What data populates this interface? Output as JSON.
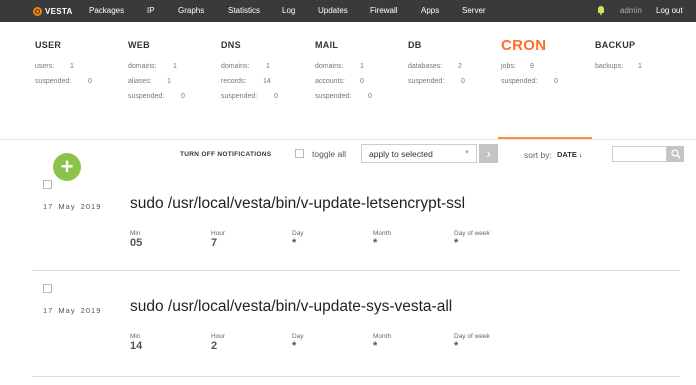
{
  "brand": {
    "logo_text": "VESTA"
  },
  "nav": {
    "items": [
      "Packages",
      "IP",
      "Graphs",
      "Statistics",
      "Log",
      "Updates",
      "Firewall",
      "Apps",
      "Server"
    ],
    "user": "admin",
    "logout": "Log out"
  },
  "stats": [
    {
      "title": "USER",
      "lines": [
        {
          "label": "users:",
          "value": "1"
        },
        {
          "label": "suspended:",
          "value": "0"
        }
      ]
    },
    {
      "title": "WEB",
      "lines": [
        {
          "label": "domains:",
          "value": "1"
        },
        {
          "label": "aliases:",
          "value": "1"
        },
        {
          "label": "suspended:",
          "value": "0"
        }
      ]
    },
    {
      "title": "DNS",
      "lines": [
        {
          "label": "domains:",
          "value": "1"
        },
        {
          "label": "records:",
          "value": "14"
        },
        {
          "label": "suspended:",
          "value": "0"
        }
      ]
    },
    {
      "title": "MAIL",
      "lines": [
        {
          "label": "domains:",
          "value": "1"
        },
        {
          "label": "accounts:",
          "value": "0"
        },
        {
          "label": "suspended:",
          "value": "0"
        }
      ]
    },
    {
      "title": "DB",
      "lines": [
        {
          "label": "databases:",
          "value": "2"
        },
        {
          "label": "suspended:",
          "value": "0"
        }
      ]
    },
    {
      "title": "CRON",
      "lines": [
        {
          "label": "jobs:",
          "value": "9"
        },
        {
          "label": "suspended:",
          "value": "0"
        }
      ]
    },
    {
      "title": "BACKUP",
      "lines": [
        {
          "label": "backups:",
          "value": "1"
        }
      ]
    }
  ],
  "toolbar": {
    "add": "+",
    "notifications": "TURN OFF NOTIFICATIONS",
    "toggle_all": "toggle all",
    "apply_selected": "apply to selected",
    "sort_by": "sort by:",
    "sort_value": "DATE ↓"
  },
  "field_labels": [
    "Min",
    "Hour",
    "Day",
    "Month",
    "Day of week"
  ],
  "jobs": [
    {
      "date": "17 May 2019",
      "command": "sudo /usr/local/vesta/bin/v-update-letsencrypt-ssl",
      "values": [
        "05",
        "7",
        "*",
        "*",
        "*"
      ]
    },
    {
      "date": "17 May 2019",
      "command": "sudo /usr/local/vesta/bin/v-update-sys-vesta-all",
      "values": [
        "14",
        "2",
        "*",
        "*",
        "*"
      ]
    }
  ]
}
